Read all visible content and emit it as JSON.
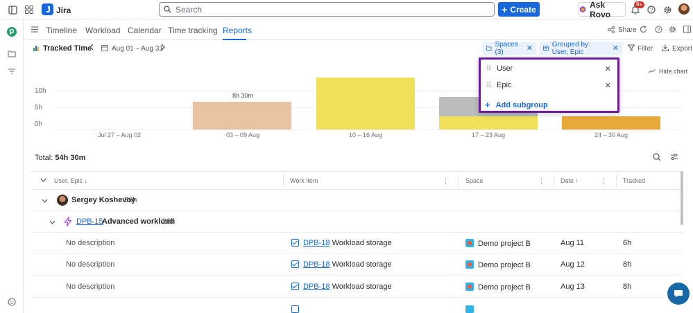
{
  "topbar": {
    "app_name": "Jira",
    "search_placeholder": "Search",
    "create_label": "Create",
    "ask_rovo_label": "Ask Rovo",
    "notification_badge": "9+"
  },
  "nav": {
    "tabs": [
      {
        "label": "Timeline",
        "active": false
      },
      {
        "label": "Workload",
        "active": false
      },
      {
        "label": "Calendar",
        "active": false
      },
      {
        "label": "Time tracking",
        "active": false
      },
      {
        "label": "Reports",
        "active": true
      }
    ],
    "share_label": "Share"
  },
  "toolbar": {
    "title": "Tracked Time",
    "date_range": "Aug 01 – Aug 31",
    "spaces_chip": "Spaces (3)",
    "grouped_chip": "Grouped by: User, Epic",
    "filter_label": "Filter",
    "export_label": "Export",
    "hide_chart_label": "Hide chart"
  },
  "chart_data": {
    "type": "bar",
    "stacked": true,
    "categories": [
      "Jul 27 – Aug 02",
      "03 – 09 Aug",
      "10 – 16 Aug",
      "17 – 23 Aug",
      "24 – 30 Aug"
    ],
    "ytick_labels": [
      "10h",
      "5h",
      "0h"
    ],
    "ylim": [
      0,
      16
    ],
    "series": [
      {
        "color": "#e8c3a4",
        "values": [
          0,
          8.5,
          0,
          0,
          0
        ]
      },
      {
        "color": "#f0e05a",
        "values": [
          0,
          0,
          16,
          4,
          0
        ]
      },
      {
        "color": "#bcbcbc",
        "values": [
          0,
          0,
          0,
          6,
          0
        ]
      },
      {
        "color": "#e6a93a",
        "values": [
          0,
          0,
          0,
          0,
          4
        ]
      }
    ],
    "data_labels": [
      "",
      "8h 30m",
      "",
      "",
      ""
    ]
  },
  "group_popup": {
    "items": [
      "User",
      "Epic"
    ],
    "add_label": "Add subgroup"
  },
  "summary": {
    "total_prefix": "Total:",
    "total_value": "54h 30m"
  },
  "table": {
    "headers": {
      "group": "User, Epic",
      "work_item": "Work item",
      "space": "Space",
      "date": "Date",
      "tracked": "Tracked"
    },
    "user_row": {
      "name": "Sergey Koshevoy",
      "hours": "36h"
    },
    "epic_row": {
      "key": "DPB-15",
      "title": "Advanced workload",
      "hours": "36h"
    },
    "rows": [
      {
        "description": "No description",
        "key": "DPB-18",
        "title": "Workload storage",
        "space": "Demo project B",
        "date": "Aug 11",
        "tracked": "6h"
      },
      {
        "description": "No description",
        "key": "DPB-18",
        "title": "Workload storage",
        "space": "Demo project B",
        "date": "Aug 12",
        "tracked": "8h"
      },
      {
        "description": "No description",
        "key": "DPB-18",
        "title": "Workload storage",
        "space": "Demo project B",
        "date": "Aug 13",
        "tracked": "8h"
      }
    ]
  }
}
